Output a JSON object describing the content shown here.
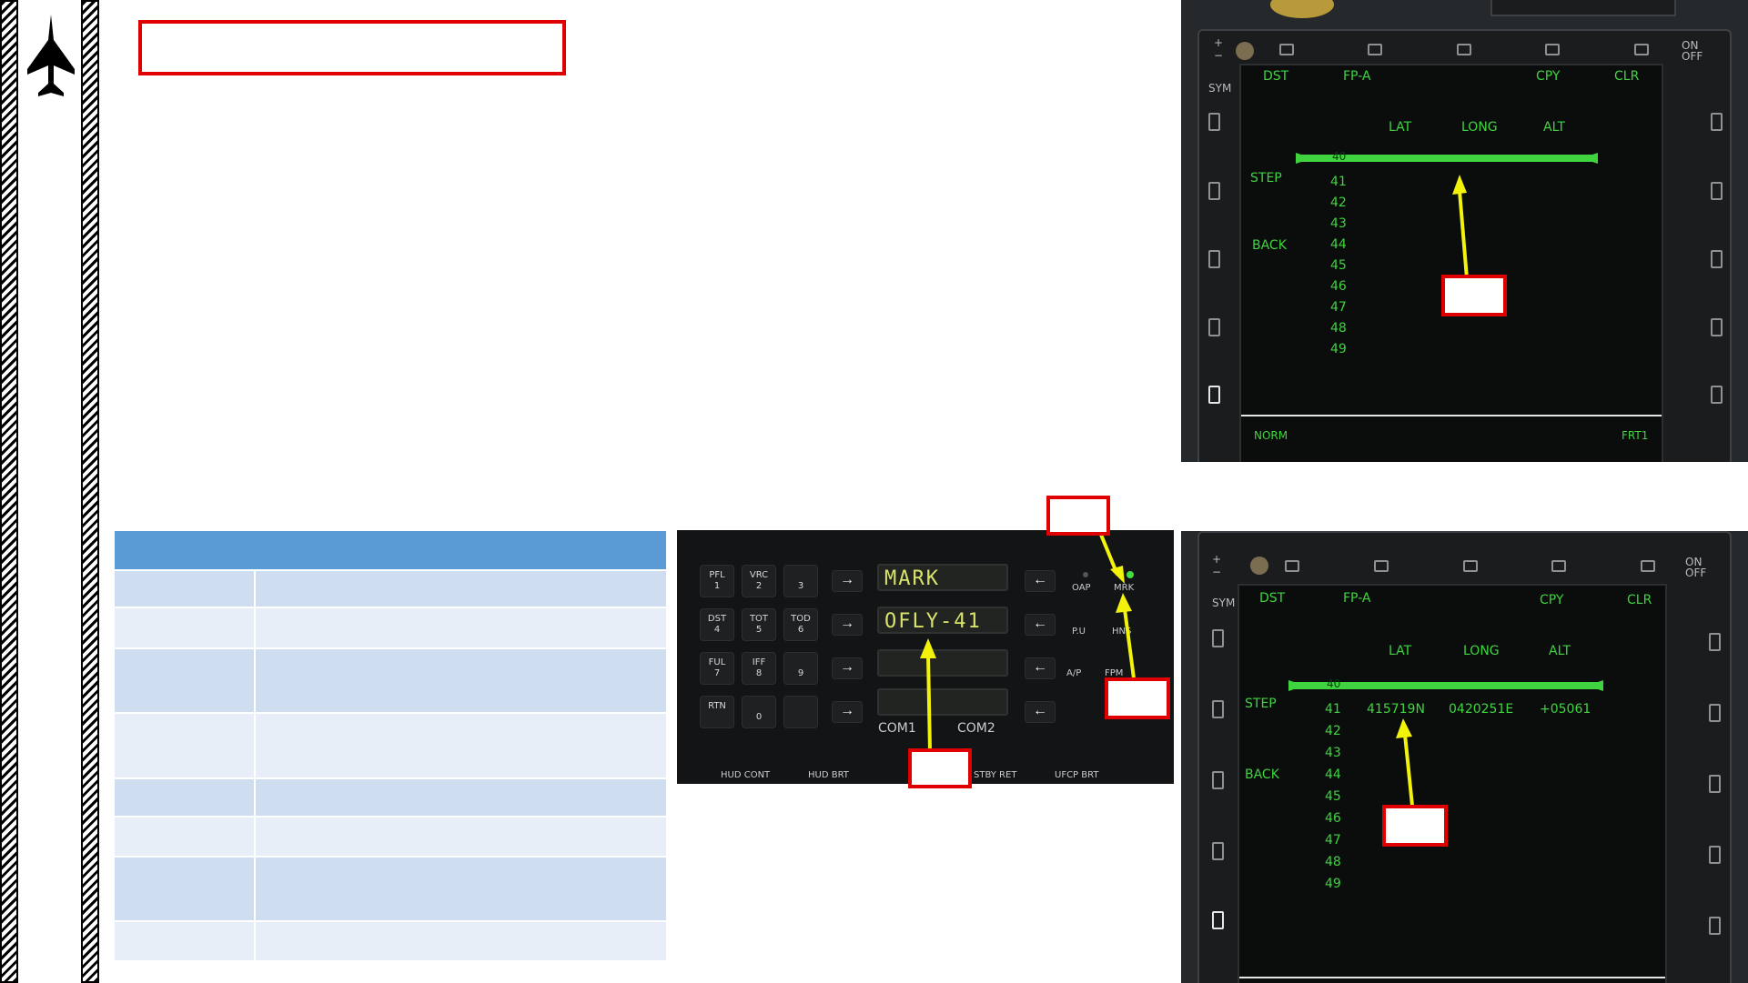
{
  "mfd_top": {
    "top_labels": [
      "DST",
      "FP-A",
      "CPY",
      "CLR"
    ],
    "sym": "SYM",
    "on_off": "ON OFF",
    "headers": [
      "LAT",
      "LONG",
      "ALT"
    ],
    "left_labels": [
      "STEP",
      "BACK"
    ],
    "selected_step": "40",
    "steps": [
      "41",
      "42",
      "43",
      "44",
      "45",
      "46",
      "47",
      "48",
      "49"
    ],
    "bottom_left": "NORM",
    "bottom_right": "FRT1"
  },
  "mfd_bottom": {
    "top_labels": [
      "DST",
      "FP-A",
      "CPY",
      "CLR"
    ],
    "sym": "SYM",
    "on_off": "ON OFF",
    "headers": [
      "LAT",
      "LONG",
      "ALT"
    ],
    "left_labels": [
      "STEP",
      "BACK"
    ],
    "selected_step": "40",
    "steps": [
      "41",
      "42",
      "43",
      "44",
      "45",
      "46",
      "47",
      "48",
      "49"
    ],
    "row41": {
      "lat": "415719N",
      "long": "0420251E",
      "alt": "+05061"
    }
  },
  "ufc": {
    "keys": [
      {
        "label": "PFL",
        "num": "1"
      },
      {
        "label": "VRC",
        "num": "2"
      },
      {
        "label": "",
        "num": "3"
      },
      {
        "label": "DST",
        "num": "4"
      },
      {
        "label": "TOT",
        "num": "5"
      },
      {
        "label": "TOD",
        "num": "6"
      },
      {
        "label": "FUL",
        "num": "7"
      },
      {
        "label": "IFF",
        "num": "8"
      },
      {
        "label": "",
        "num": "9"
      },
      {
        "label": "RTN",
        "num": ""
      },
      {
        "label": "",
        "num": "0"
      },
      {
        "label": "",
        "num": ""
      }
    ],
    "display_line1": "MARK",
    "display_line2": "OFLY-41",
    "right_buttons": [
      "OAP",
      "MRK",
      "P.U",
      "HNS",
      "A/P",
      "FPM"
    ],
    "com1": "COM1",
    "com2": "COM2",
    "bottom_labels": [
      "HUD CONT",
      "HUD BRT",
      "STBY RET",
      "UFCP BRT"
    ]
  },
  "colors": {
    "highlight_red": "#e00000",
    "mfd_green": "#3fd43f",
    "arrow_yellow": "#f2f20a",
    "table_header": "#5b9bd5"
  }
}
